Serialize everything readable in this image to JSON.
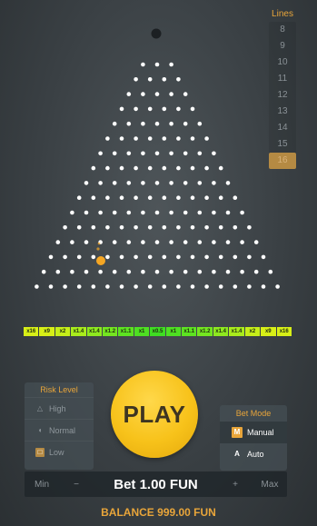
{
  "lines": {
    "title": "Lines",
    "options": [
      "8",
      "9",
      "10",
      "11",
      "12",
      "13",
      "14",
      "15",
      "16"
    ],
    "selected": "16"
  },
  "board": {
    "pins_rows": 16
  },
  "multipliers": [
    {
      "label": "x16",
      "color": "#d7ef17"
    },
    {
      "label": "x9",
      "color": "#d7ef17"
    },
    {
      "label": "x2",
      "color": "#c6ee19"
    },
    {
      "label": "x1.4",
      "color": "#a9ec1c"
    },
    {
      "label": "x1.4",
      "color": "#8ee91f"
    },
    {
      "label": "x1.2",
      "color": "#74e620"
    },
    {
      "label": "x1.1",
      "color": "#5de321"
    },
    {
      "label": "x1",
      "color": "#4ee022"
    },
    {
      "label": "x0.5",
      "color": "#3fdd22"
    },
    {
      "label": "x1",
      "color": "#4ee022"
    },
    {
      "label": "x1.1",
      "color": "#5de321"
    },
    {
      "label": "x1.2",
      "color": "#74e620"
    },
    {
      "label": "x1.4",
      "color": "#8ee91f"
    },
    {
      "label": "x1.4",
      "color": "#a9ec1c"
    },
    {
      "label": "x2",
      "color": "#c6ee19"
    },
    {
      "label": "x9",
      "color": "#d7ef17"
    },
    {
      "label": "x16",
      "color": "#d7ef17"
    }
  ],
  "risk": {
    "title": "Risk Level",
    "items": [
      {
        "label": "High",
        "icon": "flame-icon"
      },
      {
        "label": "Normal",
        "icon": "gauge-icon"
      },
      {
        "label": "Low",
        "icon": "lock-icon"
      }
    ],
    "selected": "Low"
  },
  "play": {
    "label": "PLAY"
  },
  "mode": {
    "title": "Bet Mode",
    "items": [
      {
        "badge": "M",
        "label": "Manual"
      },
      {
        "badge": "A",
        "label": "Auto"
      }
    ],
    "selected": "Manual"
  },
  "bet": {
    "min_label": "Min",
    "minus_label": "−",
    "label": "Bet 1.00 FUN",
    "plus_label": "+",
    "max_label": "Max"
  },
  "balance": {
    "label": "BALANCE 999.00 FUN"
  },
  "colors": {
    "accent": "#e8a53a",
    "play": "#f7c21a",
    "ball": "#f5a623"
  }
}
